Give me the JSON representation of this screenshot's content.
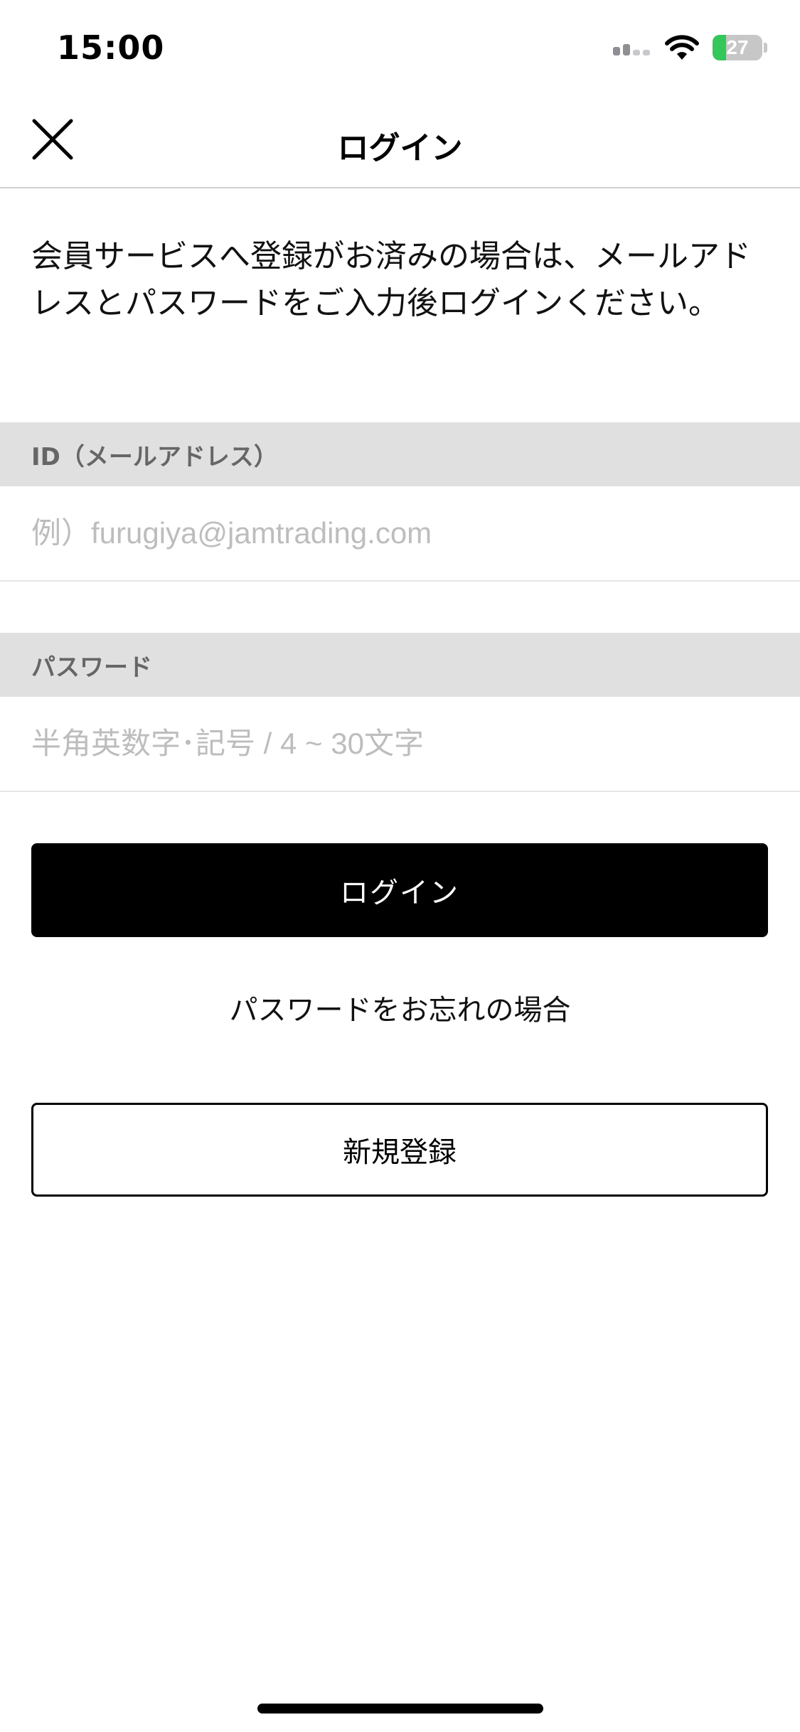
{
  "status_bar": {
    "time": "15:00",
    "battery_level": "27",
    "battery_fraction": 0.27,
    "battery_color": "#34c759",
    "icons": [
      "signal-icon",
      "wifi-icon",
      "battery-icon"
    ]
  },
  "nav": {
    "title": "ログイン",
    "close_icon": "close-icon"
  },
  "intro_text": "会員サービスへ登録がお済みの場合は、メールアドレスとパスワードをご入力後ログインください。",
  "form": {
    "id_label": "ID（メールアドレス）",
    "id_placeholder": "例）furugiya@jamtrading.com",
    "password_label": "パスワード",
    "password_placeholder": "半角英数字･記号 / 4 ~ 30文字"
  },
  "actions": {
    "login_label": "ログイン",
    "forgot_label": "パスワードをお忘れの場合",
    "register_label": "新規登録"
  },
  "colors": {
    "primary_button": "#000000",
    "section_header_bg": "#e0e0e0",
    "placeholder": "#bdbdbd"
  }
}
